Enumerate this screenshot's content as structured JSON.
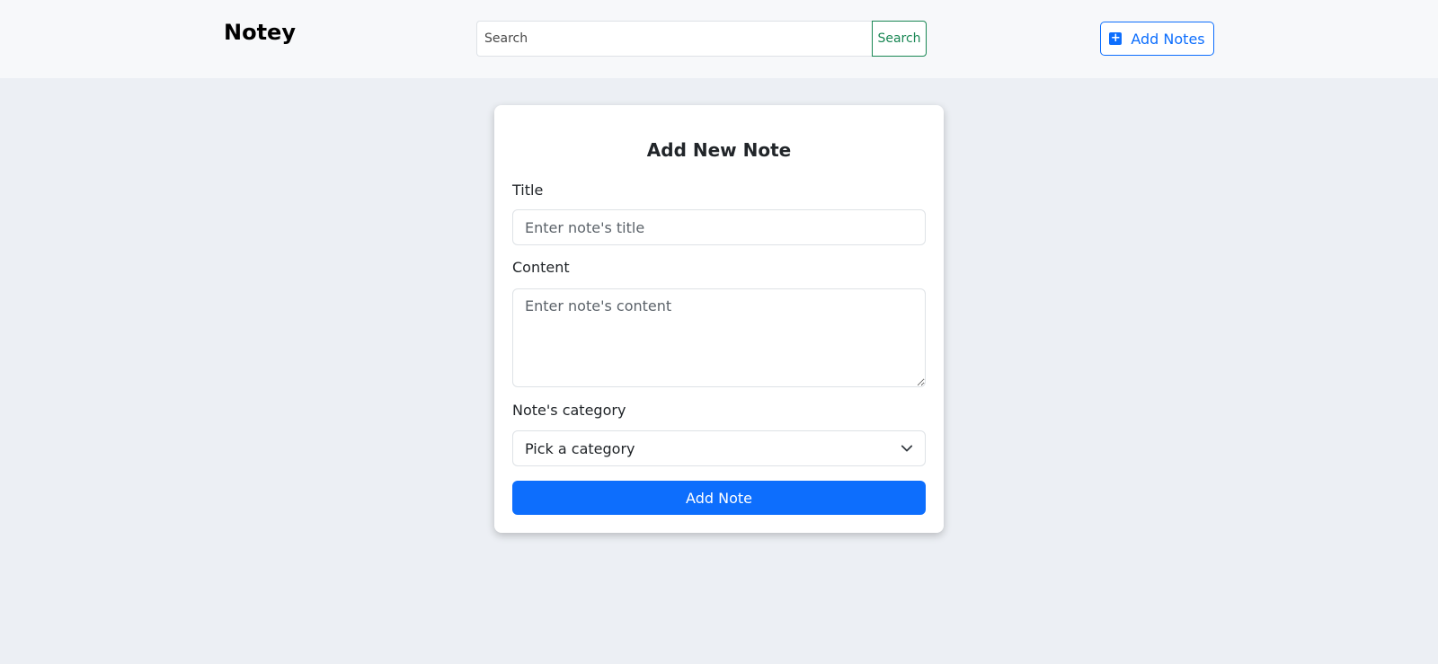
{
  "navbar": {
    "brand": "Notey",
    "search": {
      "placeholder": "Search",
      "button_label": "Search"
    },
    "add_notes_button": {
      "label": "Add Notes",
      "icon": "plus-square-icon"
    }
  },
  "form": {
    "heading": "Add New Note",
    "title_field": {
      "label": "Title",
      "placeholder": "Enter note's title"
    },
    "content_field": {
      "label": "Content",
      "placeholder": "Enter note's content"
    },
    "category_field": {
      "label": "Note's category",
      "selected": "Pick a category",
      "icon": "chevron-down-icon"
    },
    "submit_label": "Add Note"
  },
  "colors": {
    "primary": "#0d6efd",
    "success": "#198754",
    "page_background": "#eceff4",
    "navbar_background": "#f7f8fa"
  }
}
